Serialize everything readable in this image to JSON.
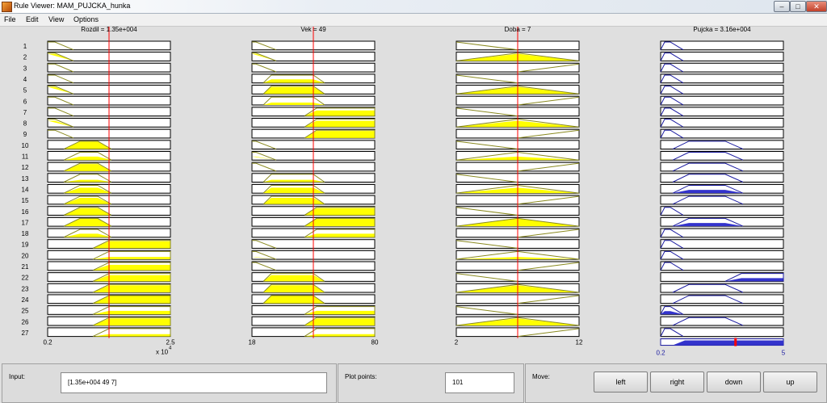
{
  "window": {
    "title": "Rule Viewer: MAM_PUJCKA_hunka"
  },
  "menu": [
    "File",
    "Edit",
    "View",
    "Options"
  ],
  "columns": [
    {
      "name": "Rozdil",
      "title": "Rozdil = 1.35e+004",
      "range": [
        2000,
        25000
      ],
      "tick_min": "0.2",
      "tick_max": "2.5",
      "exponent": "x 10",
      "exp_power": "4",
      "color": "#ffff00",
      "input": 13500
    },
    {
      "name": "Vek",
      "title": "Vek = 49",
      "range": [
        18,
        80
      ],
      "tick_min": "18",
      "tick_max": "80",
      "color": "#ffff00",
      "input": 49
    },
    {
      "name": "Doba",
      "title": "Doba = 7",
      "range": [
        2,
        12
      ],
      "tick_min": "2",
      "tick_max": "12",
      "color": "#ffff00",
      "input": 7
    },
    {
      "name": "Pujcka",
      "title": "Pujcka = 3.16e+004",
      "range": [
        0.2,
        5
      ],
      "tick_min": "0.2",
      "tick_max": "5",
      "color": "#3333cc",
      "output_fraction": 0.61
    }
  ],
  "rules": {
    "labels": [
      "1",
      "2",
      "3",
      "4",
      "5",
      "6",
      "7",
      "8",
      "9",
      "10",
      "11",
      "12",
      "13",
      "14",
      "15",
      "16",
      "17",
      "18",
      "19",
      "20",
      "21",
      "22",
      "23",
      "24",
      "25",
      "26",
      "27"
    ],
    "antecedents": [
      [
        "L",
        "L",
        "L",
        "L",
        "L",
        "L",
        "L",
        "L",
        "L",
        "M",
        "M",
        "M",
        "M",
        "M",
        "M",
        "M",
        "M",
        "M",
        "H",
        "H",
        "H",
        "H",
        "H",
        "H",
        "H",
        "H",
        "H"
      ],
      [
        "L",
        "L",
        "L",
        "M",
        "M",
        "M",
        "H",
        "H",
        "H",
        "L",
        "L",
        "L",
        "M",
        "M",
        "M",
        "H",
        "H",
        "H",
        "L",
        "L",
        "L",
        "M",
        "M",
        "M",
        "H",
        "H",
        "H"
      ],
      [
        "L",
        "M",
        "H",
        "L",
        "M",
        "H",
        "L",
        "M",
        "H",
        "L",
        "M",
        "H",
        "L",
        "M",
        "H",
        "L",
        "M",
        "H",
        "L",
        "M",
        "H",
        "L",
        "M",
        "H",
        "L",
        "M",
        "H"
      ]
    ],
    "consequents": [
      "L",
      "L",
      "L",
      "L",
      "L",
      "L",
      "L",
      "L",
      "L",
      "M",
      "M",
      "M",
      "M",
      "M",
      "M",
      "L",
      "M",
      "L",
      "L",
      "L",
      "L",
      "H",
      "M",
      "M",
      "L",
      "M",
      "L"
    ],
    "consequent_filled": [
      0,
      0,
      0,
      0,
      0,
      0,
      0,
      0,
      0,
      0,
      0,
      0,
      0,
      1,
      0,
      0,
      1,
      0,
      0,
      0,
      0,
      1,
      0,
      0,
      1,
      0,
      0
    ]
  },
  "controls": {
    "input_label": "Input:",
    "input_value": "[1.35e+004 49 7]",
    "plot_points_label": "Plot points:",
    "plot_points_value": "101",
    "move_label": "Move:",
    "buttons": [
      "left",
      "right",
      "down",
      "up"
    ]
  }
}
